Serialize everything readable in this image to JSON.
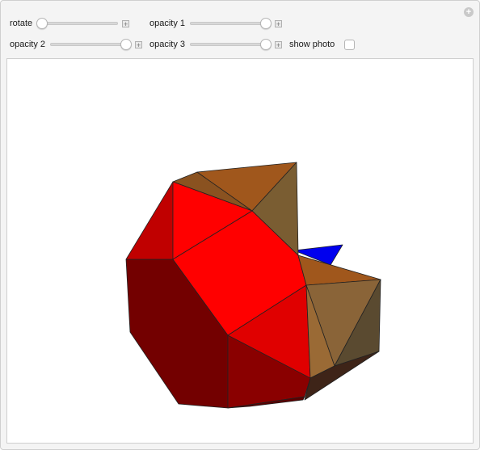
{
  "controls": {
    "rotate": {
      "label": "rotate",
      "value": 0.0
    },
    "opacity1": {
      "label": "opacity 1",
      "value": 1.0
    },
    "opacity2": {
      "label": "opacity 2",
      "value": 1.0
    },
    "opacity3": {
      "label": "opacity 3",
      "value": 1.0
    },
    "show_photo": {
      "label": "show photo",
      "checked": false
    }
  },
  "colors": {
    "red_faces": "#ff0000",
    "brown_faces": "#a0571c",
    "blue_face": "#0000ee",
    "edge": "#222222"
  }
}
